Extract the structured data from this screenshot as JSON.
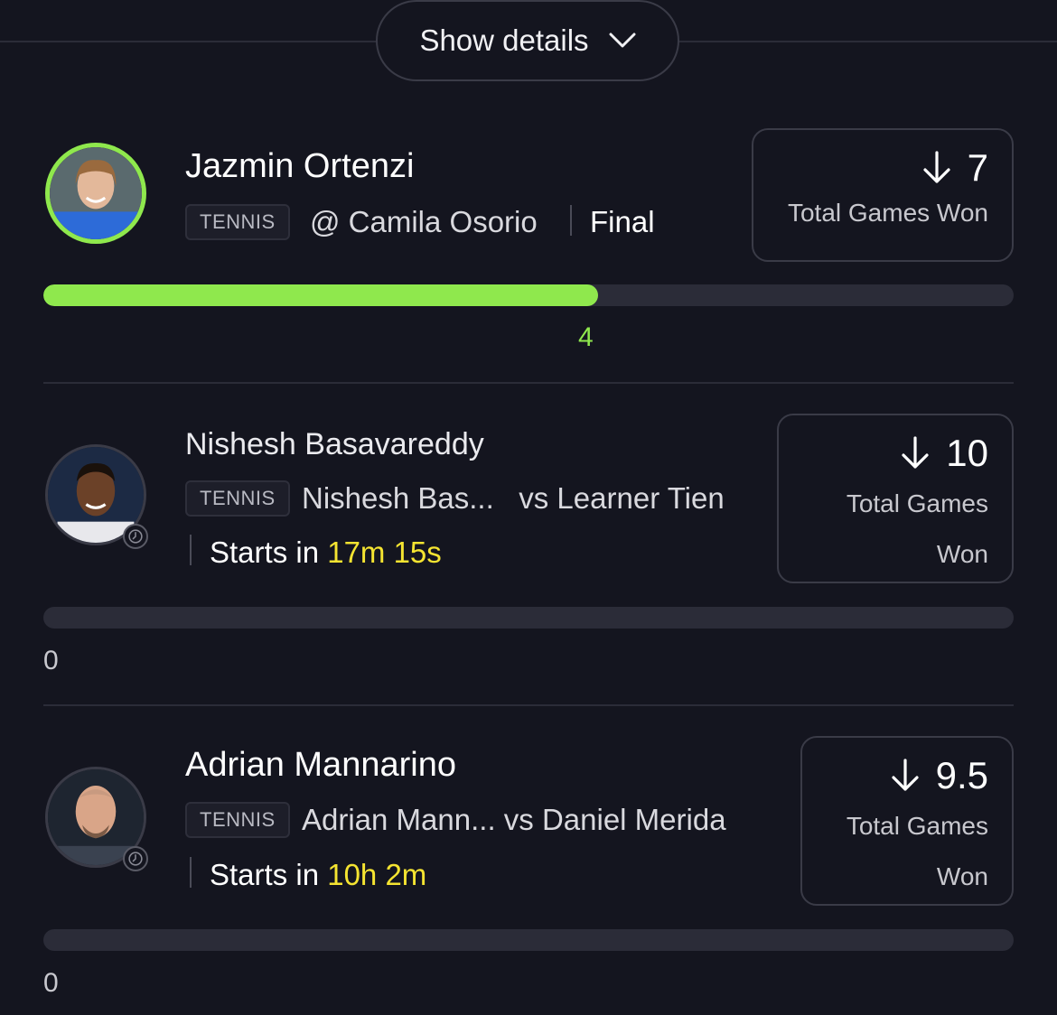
{
  "header": {
    "show_details_label": "Show details"
  },
  "picks": [
    {
      "player": "Jazmin Ortenzi",
      "sport": "TENNIS",
      "matchup": "@ Camila Osorio",
      "status": "Final",
      "direction_icon": "arrow-down-icon",
      "line": "7",
      "stat": "Total Games Won",
      "current": "4",
      "progress_fraction": 0.5714
    },
    {
      "player": "Nishesh Basavareddy",
      "sport": "TENNIS",
      "matchup": "Nishesh Bas...   vs Learner Tien",
      "status_prefix": "Starts in",
      "countdown": "17m 15s",
      "direction_icon": "arrow-down-icon",
      "line": "10",
      "stat_line1": "Total Games",
      "stat_line2": "Won",
      "current": "0",
      "progress_fraction": 0
    },
    {
      "player": "Adrian Mannarino",
      "sport": "TENNIS",
      "matchup": "Adrian Mann... vs Daniel Merida",
      "status_prefix": "Starts in",
      "countdown": "10h 2m",
      "direction_icon": "arrow-down-icon",
      "line": "9.5",
      "stat_line1": "Total Games",
      "stat_line2": "Won",
      "current": "0",
      "progress_fraction": 0
    }
  ],
  "colors": {
    "accent": "#8fe84d",
    "countdown": "#f5e431",
    "background": "#14151f"
  }
}
